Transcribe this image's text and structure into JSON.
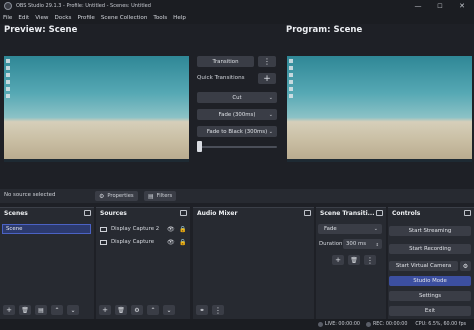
{
  "window": {
    "title": "OBS Studio 29.1.3 - Profile: Untitled - Scenes: Untitled",
    "controls": {
      "minimize": "—",
      "maximize": "☐",
      "close": "✕"
    }
  },
  "menu": [
    "File",
    "Edit",
    "View",
    "Docks",
    "Profile",
    "Scene Collection",
    "Tools",
    "Help"
  ],
  "preview": {
    "title": "Preview: Scene"
  },
  "program": {
    "title": "Program: Scene"
  },
  "transition_panel": {
    "transition_label": "Transition",
    "menu_glyph": "⋮",
    "quick_transitions_label": "Quick Transitions",
    "add_glyph": "+",
    "cut_label": "Cut",
    "fade_label": "Fade (300ms)",
    "fade_black_label": "Fade to Black (300ms)",
    "tbar_position": 0.0
  },
  "source_bar": {
    "status": "No source selected",
    "properties_label": "Properties",
    "filters_label": "Filters"
  },
  "docks": {
    "scenes": {
      "title": "Scenes",
      "items": [
        "Scene"
      ]
    },
    "sources": {
      "title": "Sources",
      "items": [
        "Display Capture 2",
        "Display Capture"
      ]
    },
    "mixer": {
      "title": "Audio Mixer"
    },
    "transitions": {
      "title": "Scene Transiti...",
      "selected": "Fade",
      "duration_label": "Duration",
      "duration_value": "300 ms"
    },
    "controls": {
      "title": "Controls",
      "buttons": [
        "Start Streaming",
        "Start Recording",
        "Start Virtual Camera",
        "Studio Mode",
        "Settings",
        "Exit"
      ],
      "active_color": "#3c4fa0"
    }
  },
  "status_bar": {
    "live": "LIVE: 00:00:00",
    "rec": "REC: 00:00:00",
    "cpu": "CPU: 6.5%, 60.00 fps"
  },
  "colors": {
    "background": "#1e2026",
    "panel": "#272a31",
    "button": "#3a3d46",
    "accent": "#3c4fa0"
  }
}
